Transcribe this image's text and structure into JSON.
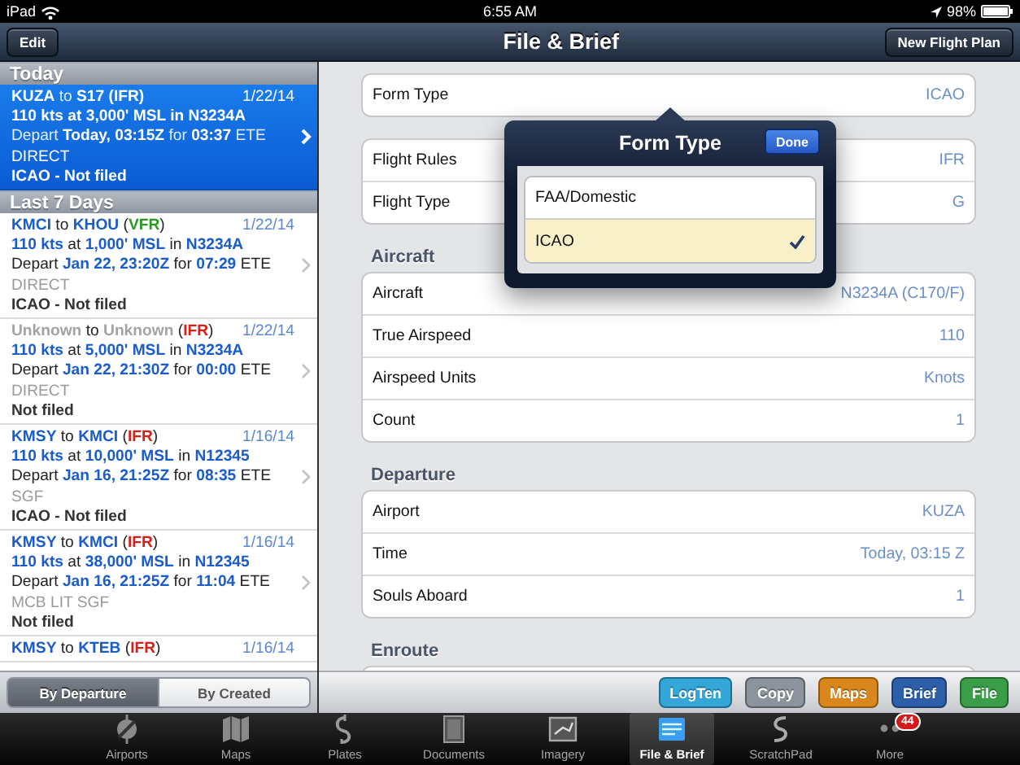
{
  "status_bar": {
    "device": "iPad",
    "time": "6:55 AM",
    "battery": "98%"
  },
  "nav_bar": {
    "left_button": "Edit",
    "title": "File & Brief",
    "right_button": "New Flight Plan"
  },
  "flight_list": {
    "sections": [
      {
        "title": "Today",
        "flights": [
          {
            "selected": true,
            "date": "1/22/14",
            "lines": [
              [
                {
                  "text": "KUZA",
                  "kind": "code"
                },
                {
                  "text": " to ",
                  "kind": "word"
                },
                {
                  "text": "S17",
                  "kind": "code"
                },
                {
                  "text": " (",
                  "kind": "code"
                },
                {
                  "text": "IFR",
                  "kind": "ifr"
                },
                {
                  "text": ")",
                  "kind": "code"
                }
              ],
              [
                {
                  "text": "110 kts",
                  "kind": "code"
                },
                {
                  "text": " at ",
                  "kind": "code"
                },
                {
                  "text": "3,000' MSL",
                  "kind": "code"
                },
                {
                  "text": " in ",
                  "kind": "code"
                },
                {
                  "text": "N3234A",
                  "kind": "code"
                }
              ],
              [
                {
                  "text": "Depart ",
                  "kind": "word"
                },
                {
                  "text": "Today, 03:15Z",
                  "kind": "code"
                },
                {
                  "text": " for ",
                  "kind": "word"
                },
                {
                  "text": "03:37",
                  "kind": "code"
                },
                {
                  "text": " ETE",
                  "kind": "word"
                }
              ],
              [
                {
                  "text": "DIRECT",
                  "kind": "route"
                }
              ],
              [
                {
                  "text": "ICAO - Not filed",
                  "kind": "note"
                }
              ]
            ]
          }
        ]
      },
      {
        "title": "Last 7 Days",
        "flights": [
          {
            "selected": false,
            "date": "1/22/14",
            "lines": [
              [
                {
                  "text": "KMCI",
                  "kind": "code"
                },
                {
                  "text": " to ",
                  "kind": "word"
                },
                {
                  "text": "KHOU",
                  "kind": "code"
                },
                {
                  "text": " (",
                  "kind": "word"
                },
                {
                  "text": "VFR",
                  "kind": "vfr"
                },
                {
                  "text": ")",
                  "kind": "word"
                }
              ],
              [
                {
                  "text": "110 kts",
                  "kind": "code"
                },
                {
                  "text": " at ",
                  "kind": "word"
                },
                {
                  "text": "1,000' MSL",
                  "kind": "code"
                },
                {
                  "text": " in ",
                  "kind": "word"
                },
                {
                  "text": "N3234A",
                  "kind": "code"
                }
              ],
              [
                {
                  "text": "Depart ",
                  "kind": "word"
                },
                {
                  "text": "Jan 22, 23:20Z",
                  "kind": "code"
                },
                {
                  "text": " for ",
                  "kind": "word"
                },
                {
                  "text": "07:29",
                  "kind": "code"
                },
                {
                  "text": " ETE",
                  "kind": "word"
                }
              ],
              [
                {
                  "text": "DIRECT",
                  "kind": "route"
                }
              ],
              [
                {
                  "text": "ICAO - Not filed",
                  "kind": "note"
                }
              ]
            ]
          },
          {
            "selected": false,
            "date": "1/22/14",
            "lines": [
              [
                {
                  "text": "Unknown",
                  "kind": "unknown"
                },
                {
                  "text": " to ",
                  "kind": "word"
                },
                {
                  "text": "Unknown",
                  "kind": "unknown"
                },
                {
                  "text": " (",
                  "kind": "word"
                },
                {
                  "text": "IFR",
                  "kind": "ifr"
                },
                {
                  "text": ")",
                  "kind": "word"
                }
              ],
              [
                {
                  "text": "110 kts",
                  "kind": "code"
                },
                {
                  "text": " at ",
                  "kind": "word"
                },
                {
                  "text": "5,000' MSL",
                  "kind": "code"
                },
                {
                  "text": " in ",
                  "kind": "word"
                },
                {
                  "text": "N3234A",
                  "kind": "code"
                }
              ],
              [
                {
                  "text": "Depart ",
                  "kind": "word"
                },
                {
                  "text": "Jan 22, 21:30Z",
                  "kind": "code"
                },
                {
                  "text": " for ",
                  "kind": "word"
                },
                {
                  "text": "00:00",
                  "kind": "code"
                },
                {
                  "text": " ETE",
                  "kind": "word"
                }
              ],
              [
                {
                  "text": "DIRECT",
                  "kind": "route"
                }
              ],
              [
                {
                  "text": "Not filed",
                  "kind": "note"
                }
              ]
            ]
          },
          {
            "selected": false,
            "date": "1/16/14",
            "lines": [
              [
                {
                  "text": "KMSY",
                  "kind": "code"
                },
                {
                  "text": " to ",
                  "kind": "word"
                },
                {
                  "text": "KMCI",
                  "kind": "code"
                },
                {
                  "text": " (",
                  "kind": "word"
                },
                {
                  "text": "IFR",
                  "kind": "ifr"
                },
                {
                  "text": ")",
                  "kind": "word"
                }
              ],
              [
                {
                  "text": "110 kts",
                  "kind": "code"
                },
                {
                  "text": " at ",
                  "kind": "word"
                },
                {
                  "text": "10,000' MSL",
                  "kind": "code"
                },
                {
                  "text": " in ",
                  "kind": "word"
                },
                {
                  "text": "N12345",
                  "kind": "code"
                }
              ],
              [
                {
                  "text": "Depart ",
                  "kind": "word"
                },
                {
                  "text": "Jan 16, 21:25Z",
                  "kind": "code"
                },
                {
                  "text": " for ",
                  "kind": "word"
                },
                {
                  "text": "08:35",
                  "kind": "code"
                },
                {
                  "text": " ETE",
                  "kind": "word"
                }
              ],
              [
                {
                  "text": "SGF",
                  "kind": "route"
                }
              ],
              [
                {
                  "text": "ICAO - Not filed",
                  "kind": "note"
                }
              ]
            ]
          },
          {
            "selected": false,
            "date": "1/16/14",
            "lines": [
              [
                {
                  "text": "KMSY",
                  "kind": "code"
                },
                {
                  "text": " to ",
                  "kind": "word"
                },
                {
                  "text": "KMCI",
                  "kind": "code"
                },
                {
                  "text": " (",
                  "kind": "word"
                },
                {
                  "text": "IFR",
                  "kind": "ifr"
                },
                {
                  "text": ")",
                  "kind": "word"
                }
              ],
              [
                {
                  "text": "110 kts",
                  "kind": "code"
                },
                {
                  "text": " at ",
                  "kind": "word"
                },
                {
                  "text": "38,000' MSL",
                  "kind": "code"
                },
                {
                  "text": " in ",
                  "kind": "word"
                },
                {
                  "text": "N12345",
                  "kind": "code"
                }
              ],
              [
                {
                  "text": "Depart ",
                  "kind": "word"
                },
                {
                  "text": "Jan 16, 21:25Z",
                  "kind": "code"
                },
                {
                  "text": " for ",
                  "kind": "word"
                },
                {
                  "text": "11:04",
                  "kind": "code"
                },
                {
                  "text": " ETE",
                  "kind": "word"
                }
              ],
              [
                {
                  "text": "MCB LIT SGF",
                  "kind": "route"
                }
              ],
              [
                {
                  "text": "Not filed",
                  "kind": "note"
                }
              ]
            ]
          },
          {
            "selected": false,
            "date": "1/16/14",
            "lines": [
              [
                {
                  "text": "KMSY",
                  "kind": "code"
                },
                {
                  "text": " to ",
                  "kind": "word"
                },
                {
                  "text": "KTEB",
                  "kind": "code"
                },
                {
                  "text": " (",
                  "kind": "word"
                },
                {
                  "text": "IFR",
                  "kind": "ifr"
                },
                {
                  "text": ")",
                  "kind": "word"
                }
              ]
            ]
          }
        ]
      }
    ],
    "sort_options": [
      {
        "label": "By Departure",
        "selected": true
      },
      {
        "label": "By Created",
        "selected": false
      }
    ]
  },
  "form": {
    "sections": [
      {
        "rows": [
          {
            "label": "Form Type",
            "value": "ICAO"
          }
        ]
      },
      {
        "rows": [
          {
            "label": "Flight Rules",
            "value": "IFR"
          },
          {
            "label": "Flight Type",
            "value": "G"
          }
        ]
      },
      {
        "header": "Aircraft",
        "rows": [
          {
            "label": "Aircraft",
            "value": "N3234A (C170/F)"
          },
          {
            "label": "True Airspeed",
            "value": "110"
          },
          {
            "label": "Airspeed Units",
            "value": "Knots"
          },
          {
            "label": "Count",
            "value": "1"
          }
        ]
      },
      {
        "header": "Departure",
        "rows": [
          {
            "label": "Airport",
            "value": "KUZA"
          },
          {
            "label": "Time",
            "value": "Today, 03:15 Z"
          },
          {
            "label": "Souls Aboard",
            "value": "1"
          }
        ]
      },
      {
        "header": "Enroute"
      }
    ],
    "toolbar_buttons": [
      {
        "label": "LogTen",
        "color": "#35a6d8"
      },
      {
        "label": "Copy",
        "color": "#8b939c"
      },
      {
        "label": "Maps",
        "color": "#d9871c"
      },
      {
        "label": "Brief",
        "color": "#2d5ea9"
      },
      {
        "label": "File",
        "color": "#3a9e48"
      }
    ]
  },
  "popover": {
    "title": "Form Type",
    "done_button": "Done",
    "options": [
      {
        "label": "FAA/Domestic",
        "selected": false
      },
      {
        "label": "ICAO",
        "selected": true
      }
    ]
  },
  "tab_bar": [
    {
      "label": "Airports",
      "selected": false
    },
    {
      "label": "Maps",
      "selected": false
    },
    {
      "label": "Plates",
      "selected": false
    },
    {
      "label": "Documents",
      "selected": false
    },
    {
      "label": "Imagery",
      "selected": false
    },
    {
      "label": "File & Brief",
      "selected": true
    },
    {
      "label": "ScratchPad",
      "selected": false
    },
    {
      "label": "More",
      "selected": false,
      "badge": "44"
    }
  ]
}
